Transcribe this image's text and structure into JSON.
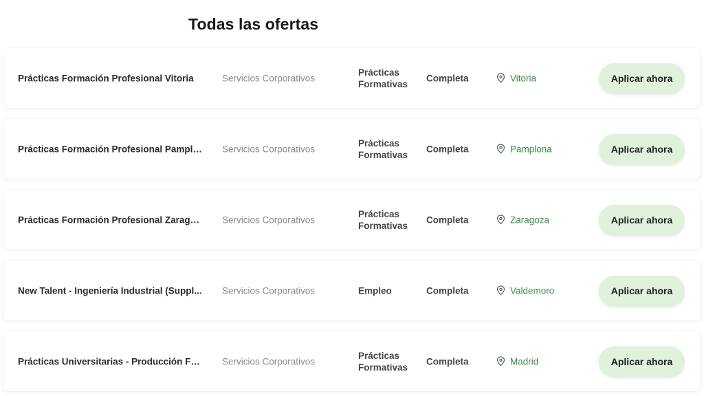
{
  "page": {
    "title": "Todas las ofertas"
  },
  "colors": {
    "location_green": "#3f8a4a",
    "button_bg": "#e0f1dc"
  },
  "offers": [
    {
      "title": "Prácticas Formación Profesional Vitoria",
      "department": "Servicios Corporativos",
      "type": "Prácticas Formativas",
      "schedule": "Completa",
      "location_icon": "map-pin-icon",
      "location": "Vitoria",
      "apply_label": "Aplicar ahora"
    },
    {
      "title": "Prácticas Formación Profesional Pamplo...",
      "department": "Servicios Corporativos",
      "type": "Prácticas Formativas",
      "schedule": "Completa",
      "location_icon": "map-pin-icon",
      "location": "Pamplona",
      "apply_label": "Aplicar ahora"
    },
    {
      "title": "Prácticas Formación Profesional Zaragoza",
      "department": "Servicios Corporativos",
      "type": "Prácticas Formativas",
      "schedule": "Completa",
      "location_icon": "map-pin-icon",
      "location": "Zaragoza",
      "apply_label": "Aplicar ahora"
    },
    {
      "title": "New Talent - Ingeniería Industrial (Suppl...",
      "department": "Servicios Corporativos",
      "type": "Empleo",
      "schedule": "Completa",
      "location_icon": "map-pin-icon",
      "location": "Valdemoro",
      "apply_label": "Aplicar ahora"
    },
    {
      "title": "Prácticas Universitarias - Producción Fot...",
      "department": "Servicios Corporativos",
      "type": "Prácticas Formativas",
      "schedule": "Completa",
      "location_icon": "map-pin-icon",
      "location": "Madrid",
      "apply_label": "Aplicar ahora"
    }
  ]
}
